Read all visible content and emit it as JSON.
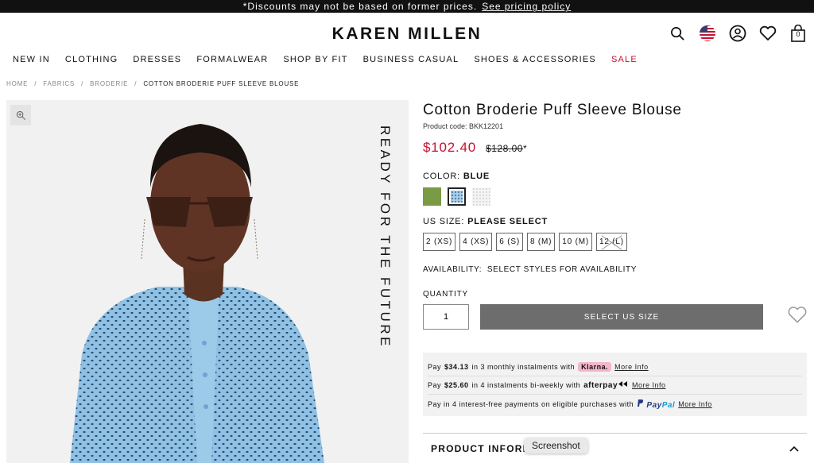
{
  "promo": {
    "text": "*Discounts may not be based on former prices.",
    "link": "See pricing policy"
  },
  "header": {
    "logo": "KAREN MILLEN",
    "cart_count": "0"
  },
  "nav": [
    "NEW IN",
    "CLOTHING",
    "DRESSES",
    "FORMALWEAR",
    "SHOP BY FIT",
    "BUSINESS CASUAL",
    "SHOES & ACCESSORIES",
    "SALE"
  ],
  "breadcrumb": [
    "HOME",
    "/",
    "FABRICS",
    "/",
    "BRODERIE",
    "/",
    "COTTON BRODERIE PUFF SLEEVE BLOUSE"
  ],
  "image": {
    "overlay_text": "READY FOR THE FUTURE"
  },
  "product": {
    "title": "Cotton Broderie Puff Sleeve Blouse",
    "code": "Product code: BKK12201",
    "price_now": "$102.40",
    "price_was": "$128.00",
    "price_was_suffix": "*",
    "color_prefix": "COLOR:",
    "color_value": "BLUE",
    "size_prefix": "US SIZE:",
    "size_value": "PLEASE SELECT",
    "sizes": [
      "2 (XS)",
      "4 (XS)",
      "6 (S)",
      "8 (M)",
      "10 (M)",
      "12 (L)"
    ],
    "availability_label": "AVAILABILITY:",
    "availability_value": "SELECT STYLES FOR AVAILABILITY",
    "quantity_label": "QUANTITY",
    "quantity_value": "1",
    "add_button": "SELECT US SIZE"
  },
  "payments": {
    "klarna": {
      "pre": "Pay",
      "amount": "$34.13",
      "mid": "in 3 monthly instalments with",
      "brand": "Klarna.",
      "more": "More Info"
    },
    "afterpay": {
      "pre": "Pay",
      "amount": "$25.60",
      "mid": "in 4 instalments bi-weekly with",
      "brand": "afterpay",
      "more": "More Info"
    },
    "paypal": {
      "text": "Pay in 4 interest-free payments on eligible purchases with",
      "brand_a": "Pay",
      "brand_b": "Pal",
      "more": "More Info"
    }
  },
  "product_info": {
    "label": "PRODUCT INFORMA"
  },
  "tooltip": "Screenshot",
  "colors": {
    "accent_red": "#c8102e",
    "button_grey": "#6d6d6d"
  }
}
